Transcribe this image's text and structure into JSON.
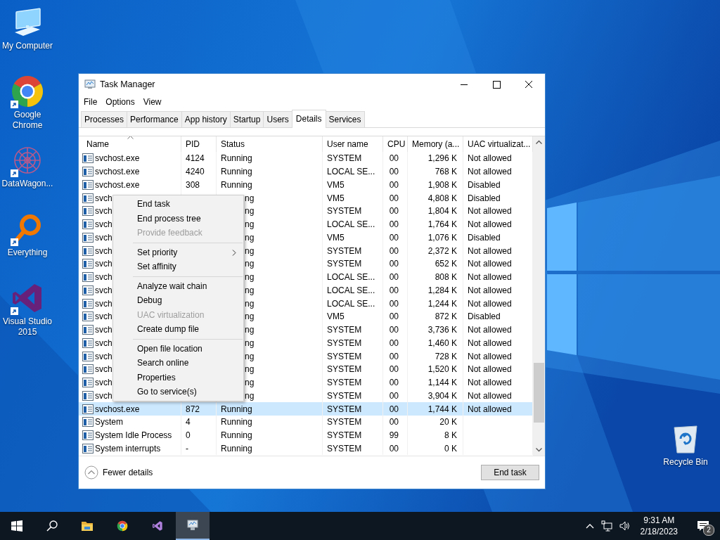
{
  "desktop_icons": [
    {
      "kind": "computer",
      "label": "My Computer",
      "shortcut": false
    },
    {
      "kind": "chrome",
      "label": "Google Chrome",
      "shortcut": true
    },
    {
      "kind": "datawagon",
      "label": "DataWagon...",
      "shortcut": true
    },
    {
      "kind": "everything",
      "label": "Everything",
      "shortcut": true
    },
    {
      "kind": "vs",
      "label": "Visual Studio 2015",
      "shortcut": true
    }
  ],
  "recycle_bin": {
    "kind": "recycle",
    "label": "Recycle Bin",
    "shortcut": false
  },
  "window": {
    "title": "Task Manager",
    "menu": [
      "File",
      "Options",
      "View"
    ],
    "tabs": [
      {
        "label": "Processes",
        "selected": false
      },
      {
        "label": "Performance",
        "selected": false
      },
      {
        "label": "App history",
        "selected": false
      },
      {
        "label": "Startup",
        "selected": false
      },
      {
        "label": "Users",
        "selected": false
      },
      {
        "label": "Details",
        "selected": true
      },
      {
        "label": "Services",
        "selected": false
      }
    ],
    "table": {
      "columns": [
        {
          "label": "Name",
          "sorted": true
        },
        {
          "label": "PID",
          "sorted": false
        },
        {
          "label": "Status",
          "sorted": false
        },
        {
          "label": "User name",
          "sorted": false
        },
        {
          "label": "CPU",
          "sorted": false
        },
        {
          "label": "Memory (a...",
          "sorted": false
        },
        {
          "label": "UAC virtualizat...",
          "sorted": false
        }
      ],
      "rows": [
        {
          "name": "svchost.exe",
          "pid": "4124",
          "status": "Running",
          "user": "SYSTEM",
          "cpu": "00",
          "memory": "1,296 K",
          "uac": "Not allowed",
          "selected": false,
          "obscured": false
        },
        {
          "name": "svchost.exe",
          "pid": "4240",
          "status": "Running",
          "user": "LOCAL SE...",
          "cpu": "00",
          "memory": "768 K",
          "uac": "Not allowed",
          "selected": false,
          "obscured": false
        },
        {
          "name": "svchost.exe",
          "pid": "308",
          "status": "Running",
          "user": "VM5",
          "cpu": "00",
          "memory": "1,908 K",
          "uac": "Disabled",
          "selected": false,
          "obscured": false
        },
        {
          "name": "svch",
          "status": "ng",
          "user": "VM5",
          "cpu": "00",
          "memory": "4,808 K",
          "uac": "Disabled",
          "selected": false,
          "obscured": true
        },
        {
          "name": "svch",
          "status": "ng",
          "user": "SYSTEM",
          "cpu": "00",
          "memory": "1,804 K",
          "uac": "Not allowed",
          "selected": false,
          "obscured": true
        },
        {
          "name": "svch",
          "status": "ng",
          "user": "LOCAL SE...",
          "cpu": "00",
          "memory": "1,764 K",
          "uac": "Not allowed",
          "selected": false,
          "obscured": true
        },
        {
          "name": "svch",
          "status": "ng",
          "user": "VM5",
          "cpu": "00",
          "memory": "1,076 K",
          "uac": "Disabled",
          "selected": false,
          "obscured": true
        },
        {
          "name": "svch",
          "status": "ng",
          "user": "SYSTEM",
          "cpu": "00",
          "memory": "2,372 K",
          "uac": "Not allowed",
          "selected": false,
          "obscured": true
        },
        {
          "name": "svch",
          "status": "ng",
          "user": "SYSTEM",
          "cpu": "00",
          "memory": "652 K",
          "uac": "Not allowed",
          "selected": false,
          "obscured": true
        },
        {
          "name": "svch",
          "status": "ng",
          "user": "LOCAL SE...",
          "cpu": "00",
          "memory": "808 K",
          "uac": "Not allowed",
          "selected": false,
          "obscured": true
        },
        {
          "name": "svch",
          "status": "ng",
          "user": "LOCAL SE...",
          "cpu": "00",
          "memory": "1,284 K",
          "uac": "Not allowed",
          "selected": false,
          "obscured": true
        },
        {
          "name": "svch",
          "status": "ng",
          "user": "LOCAL SE...",
          "cpu": "00",
          "memory": "1,244 K",
          "uac": "Not allowed",
          "selected": false,
          "obscured": true
        },
        {
          "name": "svch",
          "status": "ng",
          "user": "VM5",
          "cpu": "00",
          "memory": "872 K",
          "uac": "Disabled",
          "selected": false,
          "obscured": true
        },
        {
          "name": "svch",
          "status": "ng",
          "user": "SYSTEM",
          "cpu": "00",
          "memory": "3,736 K",
          "uac": "Not allowed",
          "selected": false,
          "obscured": true
        },
        {
          "name": "svch",
          "status": "ng",
          "user": "SYSTEM",
          "cpu": "00",
          "memory": "1,460 K",
          "uac": "Not allowed",
          "selected": false,
          "obscured": true
        },
        {
          "name": "svch",
          "status": "ng",
          "user": "SYSTEM",
          "cpu": "00",
          "memory": "728 K",
          "uac": "Not allowed",
          "selected": false,
          "obscured": true
        },
        {
          "name": "svch",
          "status": "ng",
          "user": "SYSTEM",
          "cpu": "00",
          "memory": "1,520 K",
          "uac": "Not allowed",
          "selected": false,
          "obscured": true
        },
        {
          "name": "svch",
          "status": "ng",
          "user": "SYSTEM",
          "cpu": "00",
          "memory": "1,144 K",
          "uac": "Not allowed",
          "selected": false,
          "obscured": true
        },
        {
          "name": "svch",
          "status": "ng",
          "user": "SYSTEM",
          "cpu": "00",
          "memory": "3,904 K",
          "uac": "Not allowed",
          "selected": false,
          "obscured": true
        },
        {
          "name": "svchost.exe",
          "pid": "872",
          "status": "Running",
          "user": "SYSTEM",
          "cpu": "00",
          "memory": "1,744 K",
          "uac": "Not allowed",
          "selected": true,
          "obscured": false
        },
        {
          "name": "System",
          "pid": "4",
          "status": "Running",
          "user": "SYSTEM",
          "cpu": "00",
          "memory": "20 K",
          "selected": false,
          "obscured": false
        },
        {
          "name": "System Idle Process",
          "pid": "0",
          "status": "Running",
          "user": "SYSTEM",
          "cpu": "99",
          "memory": "8 K",
          "selected": false,
          "obscured": false
        },
        {
          "name": "System interrupts",
          "pid": "-",
          "status": "Running",
          "user": "SYSTEM",
          "cpu": "00",
          "memory": "0 K",
          "selected": false,
          "obscured": false
        }
      ]
    },
    "footer": {
      "toggle": "Fewer details",
      "button": "End task"
    }
  },
  "context_menu": {
    "items": [
      {
        "kind": "item",
        "label": "End task",
        "disabled": false,
        "submenu": false
      },
      {
        "kind": "item",
        "label": "End process tree",
        "disabled": false,
        "submenu": false
      },
      {
        "kind": "item",
        "label": "Provide feedback",
        "disabled": true,
        "submenu": false
      },
      {
        "kind": "separator"
      },
      {
        "kind": "item",
        "label": "Set priority",
        "disabled": false,
        "submenu": true
      },
      {
        "kind": "item",
        "label": "Set affinity",
        "disabled": false,
        "submenu": false
      },
      {
        "kind": "separator"
      },
      {
        "kind": "item",
        "label": "Analyze wait chain",
        "disabled": false,
        "submenu": false
      },
      {
        "kind": "item",
        "label": "Debug",
        "disabled": false,
        "submenu": false
      },
      {
        "kind": "item",
        "label": "UAC virtualization",
        "disabled": true,
        "submenu": false
      },
      {
        "kind": "item",
        "label": "Create dump file",
        "disabled": false,
        "submenu": false
      },
      {
        "kind": "separator"
      },
      {
        "kind": "item",
        "label": "Open file location",
        "disabled": false,
        "submenu": false
      },
      {
        "kind": "item",
        "label": "Search online",
        "disabled": false,
        "submenu": false
      },
      {
        "kind": "item",
        "label": "Properties",
        "disabled": false,
        "submenu": false
      },
      {
        "kind": "item",
        "label": "Go to service(s)",
        "disabled": false,
        "submenu": false
      }
    ]
  },
  "taskbar": {
    "apps": [
      {
        "kind": "start",
        "active": false
      },
      {
        "kind": "search",
        "active": false
      },
      {
        "kind": "explorer",
        "active": false
      },
      {
        "kind": "chrome",
        "active": false
      },
      {
        "kind": "vs",
        "active": false
      },
      {
        "kind": "taskmgr",
        "active": true
      }
    ],
    "tray": {
      "time": "9:31 AM",
      "date": "2/18/2023",
      "notifications": "2"
    }
  }
}
